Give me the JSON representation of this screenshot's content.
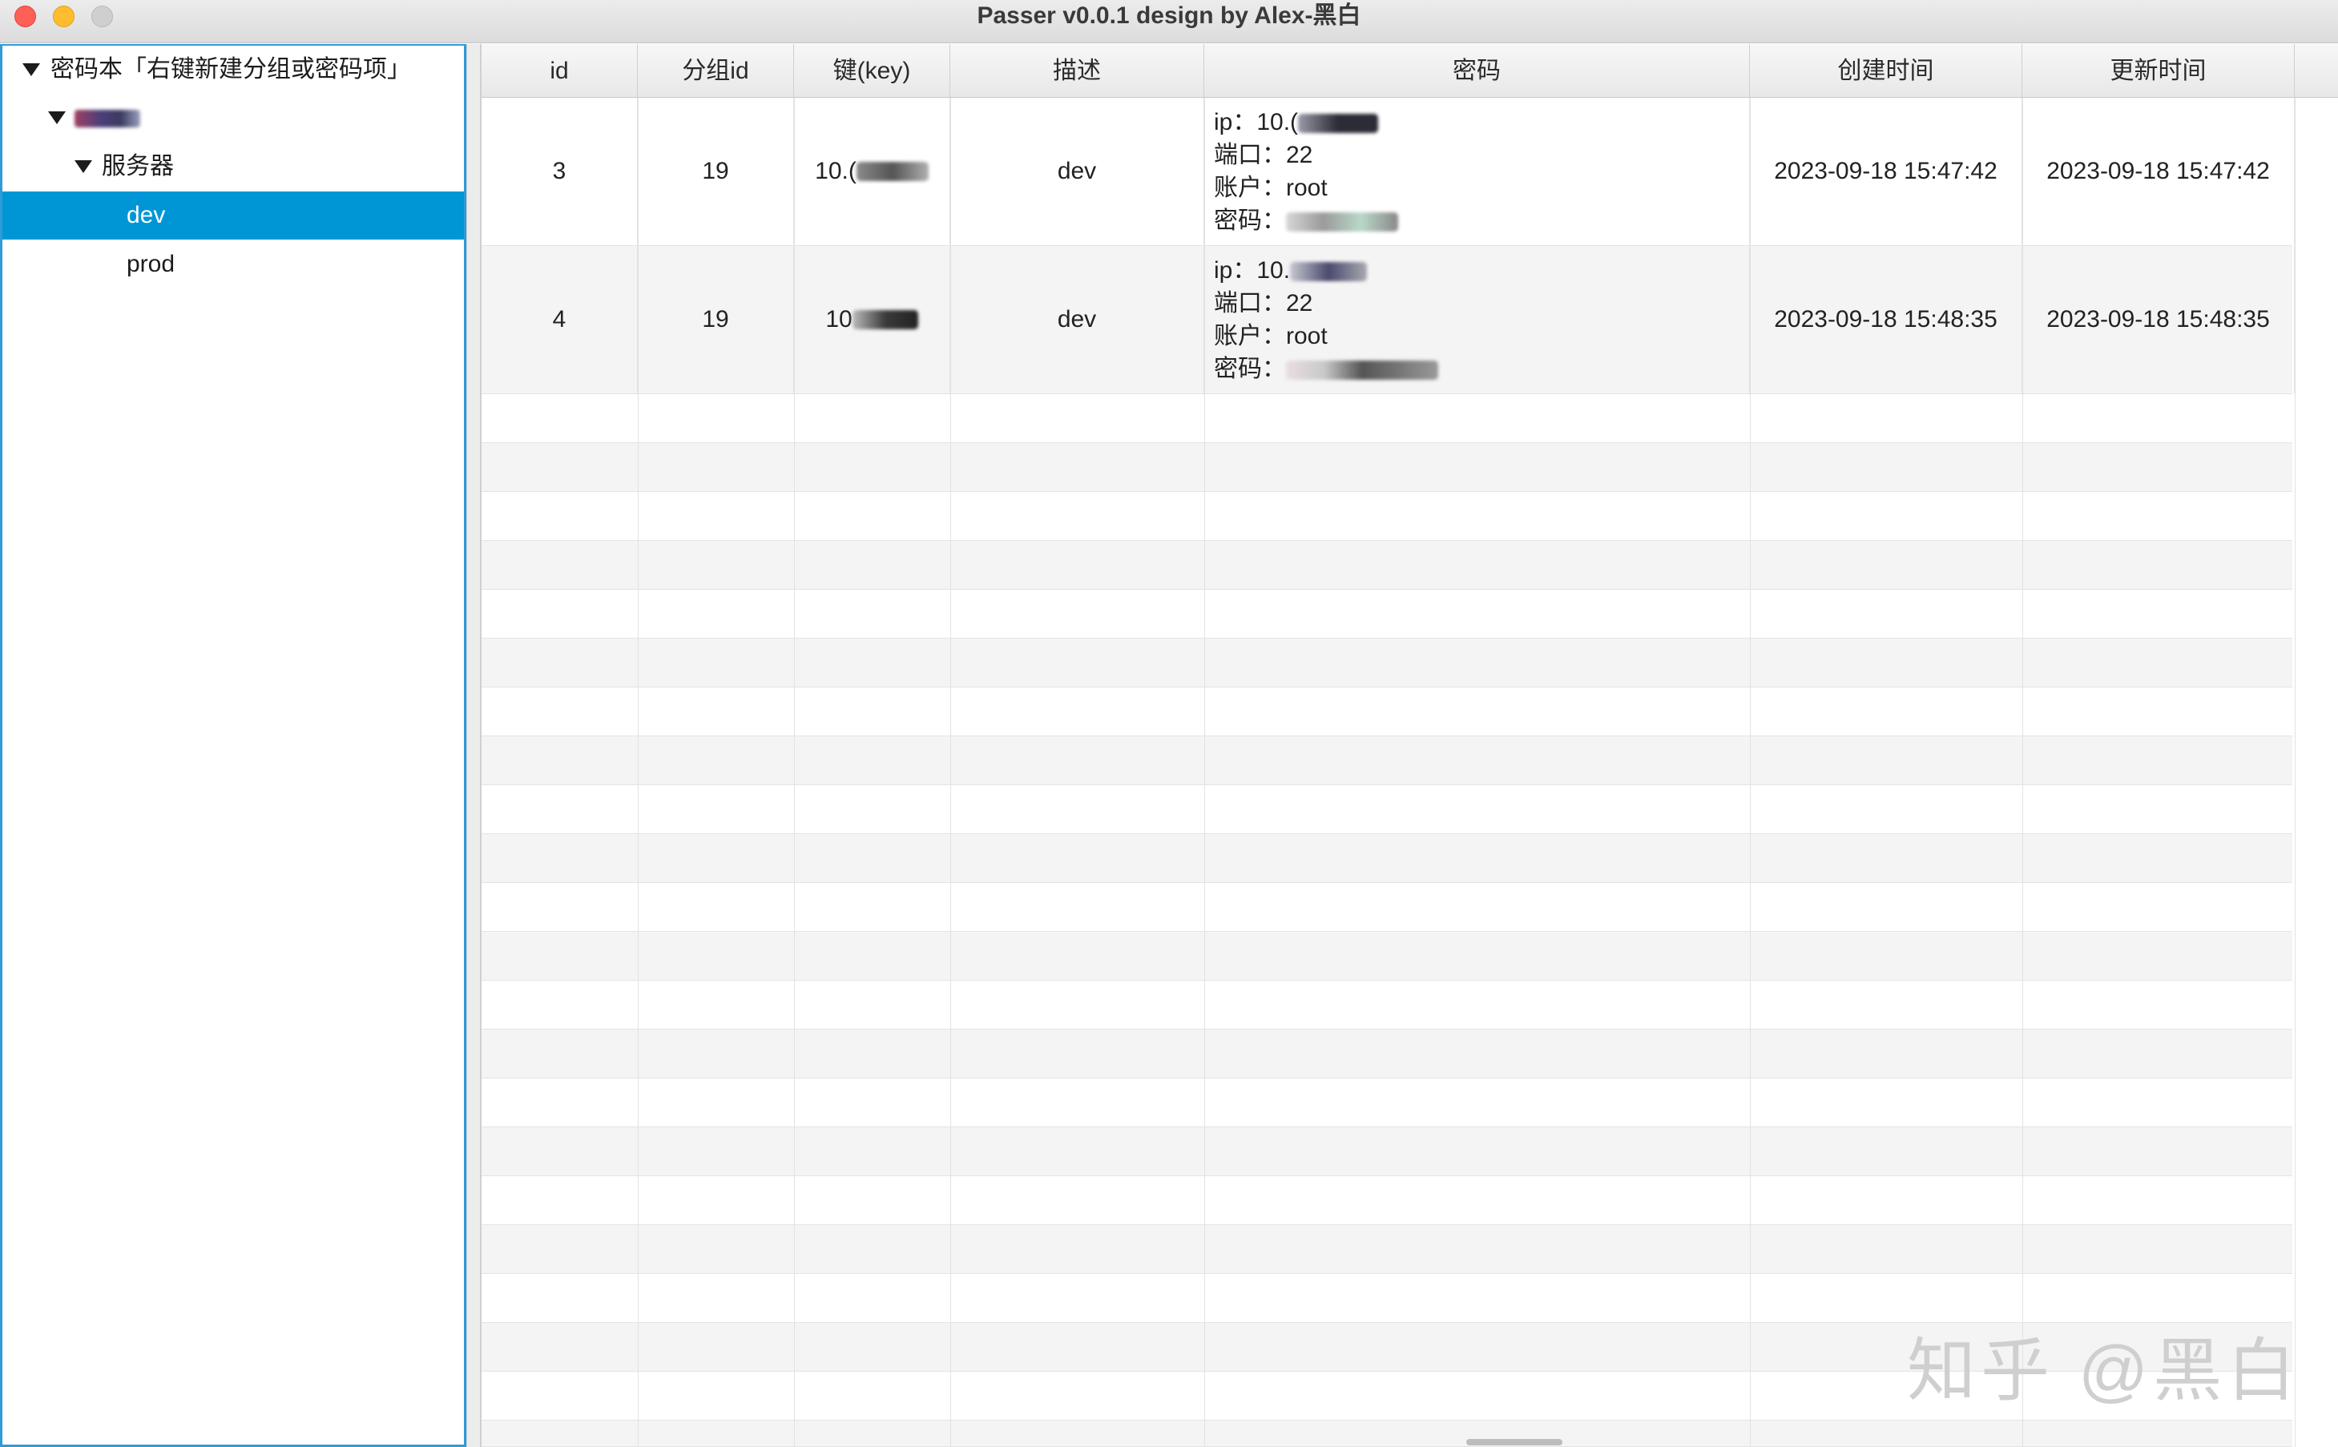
{
  "window": {
    "title": "Passer v0.0.1 design by Alex-黑白"
  },
  "tree": {
    "root": "密码本「右键新建分组或密码项」",
    "group_blurred": "",
    "subgroup": "服务器",
    "items": [
      {
        "label": "dev",
        "selected": true
      },
      {
        "label": "prod",
        "selected": false
      }
    ]
  },
  "table": {
    "headers": [
      "id",
      "分组id",
      "键(key)",
      "描述",
      "密码",
      "创建时间",
      "更新时间"
    ],
    "rows": [
      {
        "id": "3",
        "group_id": "19",
        "key": "10.(",
        "desc": "dev",
        "pw_ip": "ip：10.(",
        "pw_port": "端口：22",
        "pw_account": "账户：root",
        "pw_password": "密码：",
        "created": "2023-09-18 15:47:42",
        "updated": "2023-09-18 15:47:42"
      },
      {
        "id": "4",
        "group_id": "19",
        "key": "10",
        "desc": "dev",
        "pw_ip": "ip：10.",
        "pw_port": "端口：22",
        "pw_account": "账户：root",
        "pw_password": "密码：",
        "created": "2023-09-18 15:48:35",
        "updated": "2023-09-18 15:48:35"
      }
    ]
  },
  "watermark": "知乎 @黑白",
  "colors": {
    "selection": "#0096d6",
    "tree_border": "#2f9bd7",
    "close": "#fe5f57",
    "minimize": "#febc2e"
  }
}
